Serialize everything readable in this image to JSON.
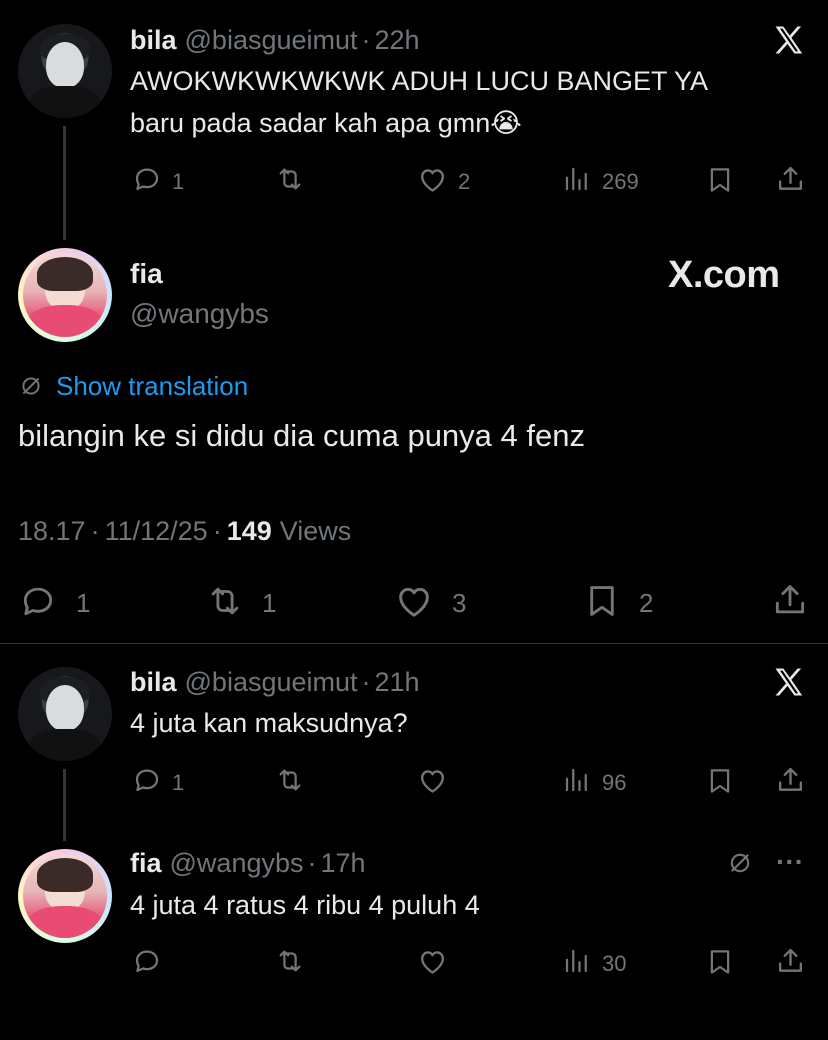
{
  "tweet1": {
    "name": "bila",
    "handle": "@biasgueimut",
    "sep": "·",
    "time": "22h",
    "line1": "AWOKWKWKWKWK ADUH LUCU BANGET YA",
    "line2": "baru pada sadar kah apa gmn",
    "emoji": "😭",
    "replies": "1",
    "likes": "2",
    "views": "269"
  },
  "main": {
    "name": "fia",
    "handle": "@wangybs",
    "brand": "X.com",
    "translate_label": "Show translation",
    "text": "bilangin ke si didu dia cuma punya 4 fenz",
    "time": "18.17",
    "date": "11/12/25",
    "sep": "·",
    "views_count": "149",
    "views_label": "Views",
    "replies": "1",
    "retweets": "1",
    "likes": "3",
    "bookmarks": "2"
  },
  "tweet2": {
    "name": "bila",
    "handle": "@biasgueimut",
    "sep": "·",
    "time": "21h",
    "text": "4 juta kan maksudnya?",
    "replies": "1",
    "views": "96"
  },
  "tweet3": {
    "name": "fia",
    "handle": "@wangybs",
    "sep": "·",
    "time": "17h",
    "text": "4 juta 4 ratus 4 ribu 4 puluh 4",
    "more": "···",
    "views": "30"
  },
  "colors": {
    "background": "#000000",
    "text": "#e7e9ea",
    "muted": "#71767b",
    "link": "#1d9bf0",
    "divider": "#2f3336"
  }
}
